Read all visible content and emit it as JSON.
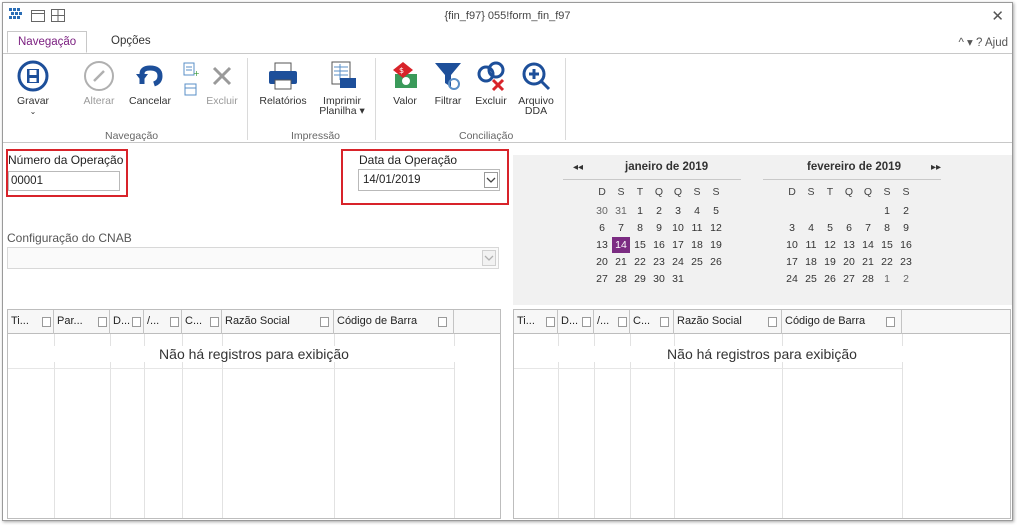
{
  "window": {
    "title": "{fin_f97} 055!form_fin_f97"
  },
  "tabs": [
    {
      "label": "Navegação",
      "active": true
    },
    {
      "label": "Opções",
      "active": false
    }
  ],
  "tabs_right": "^ ▾  ? Ajud",
  "ribbon": {
    "buttons": {
      "gravar": "Gravar",
      "alterar": "Alterar",
      "cancelar": "Cancelar",
      "excluir": "Excluir",
      "relatorios": "Relatórios",
      "imprimir1": "Imprimir",
      "imprimir2": "Planilha ▾",
      "valor": "Valor",
      "filtrar": "Filtrar",
      "excluir2": "Excluir",
      "arquivo1": "Arquivo",
      "arquivo2": "DDA"
    },
    "groups": {
      "navegacao": "Navegação",
      "impressao": "Impressão",
      "conciliacao": "Conciliação"
    }
  },
  "form": {
    "numero_label": "Número da Operação",
    "numero_value": "00001",
    "data_label": "Data da Operação",
    "data_value": "14/01/2019",
    "cnab_label": "Configuração do CNAB"
  },
  "calendar": {
    "month1": "janeiro de 2019",
    "month2": "fevereiro de 2019",
    "prev": "◂◂",
    "next": "▸▸",
    "dows": [
      "D",
      "S",
      "T",
      "Q",
      "Q",
      "S",
      "S"
    ],
    "jan": [
      [
        "30",
        "31",
        "1",
        "2",
        "3",
        "4",
        "5"
      ],
      [
        "6",
        "7",
        "8",
        "9",
        "10",
        "11",
        "12"
      ],
      [
        "13",
        "14",
        "15",
        "16",
        "17",
        "18",
        "19"
      ],
      [
        "20",
        "21",
        "22",
        "23",
        "24",
        "25",
        "26"
      ],
      [
        "27",
        "28",
        "29",
        "30",
        "31",
        "",
        ""
      ]
    ],
    "feb": [
      [
        "",
        "",
        "",
        "",
        "",
        "1",
        "2"
      ],
      [
        "3",
        "4",
        "5",
        "6",
        "7",
        "8",
        "9"
      ],
      [
        "10",
        "11",
        "12",
        "13",
        "14",
        "15",
        "16"
      ],
      [
        "17",
        "18",
        "19",
        "20",
        "21",
        "22",
        "23"
      ],
      [
        "24",
        "25",
        "26",
        "27",
        "28",
        "1",
        "2"
      ]
    ],
    "selected": "14"
  },
  "grid_left": {
    "columns": [
      "Ti...",
      "Par...",
      "D...",
      "/...",
      "C...",
      "Razão Social",
      "Código de Barra"
    ],
    "empty": "Não há registros para exibição"
  },
  "grid_right": {
    "columns": [
      "Ti...",
      "D...",
      "/...",
      "C...",
      "Razão Social",
      "Código de Barra"
    ],
    "empty": "Não há registros para exibição"
  },
  "colors": {
    "accent": "#7b1f80",
    "highlight_box": "#d8232a",
    "selected_day": "#7b2c82"
  }
}
